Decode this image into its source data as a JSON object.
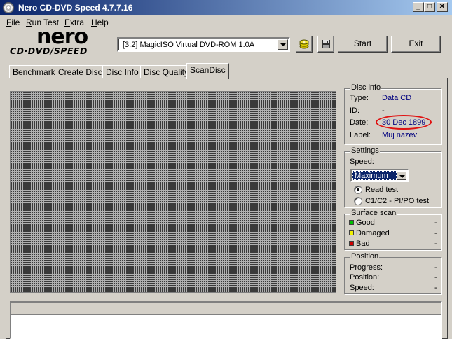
{
  "window": {
    "title": "Nero CD-DVD Speed 4.7.7.16"
  },
  "window_controls": {
    "minimize": "_",
    "maximize": "□",
    "close": "✕"
  },
  "menu": [
    {
      "label": "File",
      "mnemonic": "F",
      "rest": "ile"
    },
    {
      "label": "Run Test",
      "mnemonic": "R",
      "rest": "un Test"
    },
    {
      "label": "Extra",
      "mnemonic": "E",
      "rest": "xtra"
    },
    {
      "label": "Help",
      "mnemonic": "H",
      "rest": "elp"
    }
  ],
  "logo": {
    "main": "nero",
    "sub": "CD·DVD∕SPEED"
  },
  "drive": {
    "selected": "[3:2]   MagicISO Virtual DVD-ROM 1.0A"
  },
  "buttons": {
    "start": "Start",
    "exit": "Exit"
  },
  "tabs": [
    "Benchmark",
    "Create Disc",
    "Disc Info",
    "Disc Quality",
    "ScanDisc"
  ],
  "active_tab": "ScanDisc",
  "disc_info": {
    "title": "Disc info",
    "type_label": "Type:",
    "type_value": "Data CD",
    "id_label": "ID:",
    "id_value": "-",
    "date_label": "Date:",
    "date_value": "30 Dec 1899",
    "label_label": "Label:",
    "label_value": "Muj nazev",
    "highlight_color": "#e01010"
  },
  "settings": {
    "title": "Settings",
    "speed_label": "Speed:",
    "speed_value": "Maximum",
    "radio_read": "Read test",
    "radio_c1c2": "C1/C2 - PI/PO test",
    "selected_radio": "read"
  },
  "surface_scan": {
    "title": "Surface scan",
    "items": [
      {
        "label": "Good",
        "value": "-",
        "color": "#00c000"
      },
      {
        "label": "Damaged",
        "value": "-",
        "color": "#f0f000"
      },
      {
        "label": "Bad",
        "value": "-",
        "color": "#d00000"
      }
    ]
  },
  "position": {
    "title": "Position",
    "progress_label": "Progress:",
    "progress_value": "-",
    "position_label": "Position:",
    "position_value": "-",
    "speed_label": "Speed:",
    "speed_value": "-"
  }
}
